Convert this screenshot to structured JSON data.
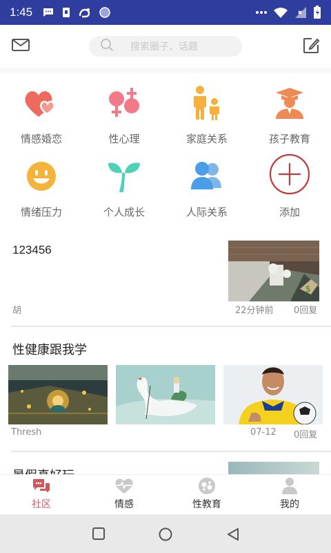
{
  "status_bar": {
    "time": "1:45"
  },
  "top_bar": {
    "search_placeholder": "搜索圈子、话题"
  },
  "categories": [
    {
      "label": "情感婚恋",
      "icon": "hearts-icon",
      "color": "#ee6a5f"
    },
    {
      "label": "性心理",
      "icon": "gender-symbols-icon",
      "color": "#f27a88"
    },
    {
      "label": "家庭关系",
      "icon": "family-icon",
      "color": "#f5b13c"
    },
    {
      "label": "孩子教育",
      "icon": "graduate-icon",
      "color": "#ee8a55"
    },
    {
      "label": "情绪压力",
      "icon": "smile-face-icon",
      "color": "#f5b33a"
    },
    {
      "label": "个人成长",
      "icon": "sprout-icon",
      "color": "#4fd1b8"
    },
    {
      "label": "人际关系",
      "icon": "people-icon",
      "color": "#4a9de6"
    },
    {
      "label": "添加",
      "icon": "add-circle-icon",
      "color": "#c0393b"
    }
  ],
  "posts": [
    {
      "title": "123456",
      "author": "胡",
      "time": "22分钟前",
      "replies": "0回复"
    },
    {
      "title": "性健康跟我学",
      "author": "Thresh",
      "date": "07-12",
      "replies": "0回复"
    },
    {
      "title": "暑假真好玩"
    }
  ],
  "bottom_nav": [
    {
      "label": "社区",
      "active": true
    },
    {
      "label": "情感",
      "active": false
    },
    {
      "label": "性教育",
      "active": false
    },
    {
      "label": "我的",
      "active": false
    }
  ],
  "colors": {
    "status_bar": "#2f3e9e",
    "accent": "#d0585c"
  }
}
